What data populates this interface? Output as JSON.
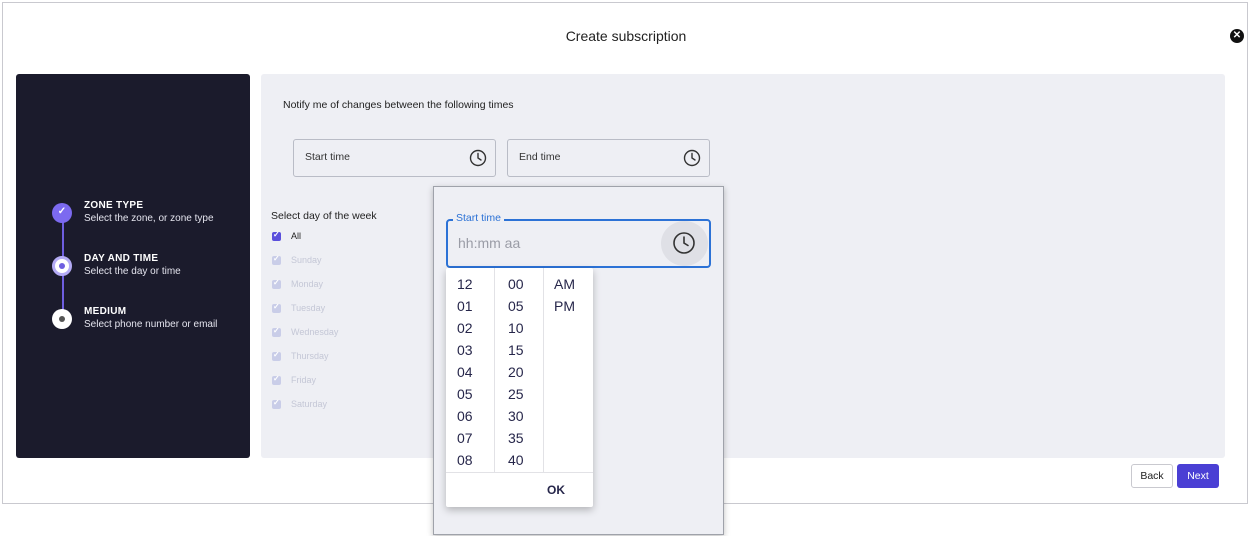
{
  "modal": {
    "title": "Create subscription"
  },
  "stepper": {
    "steps": [
      {
        "title": "ZONE TYPE",
        "subtitle": "Select the zone, or zone type",
        "state": "done"
      },
      {
        "title": "DAY AND TIME",
        "subtitle": "Select the day or time",
        "state": "active"
      },
      {
        "title": "MEDIUM",
        "subtitle": "Select phone number or email",
        "state": "idle"
      }
    ]
  },
  "form": {
    "notify_label": "Notify me of changes between the following times",
    "start_time_label": "Start time",
    "end_time_label": "End time",
    "days_label": "Select day of the week",
    "days": [
      {
        "label": "All",
        "checked": true,
        "enabled": true
      },
      {
        "label": "Sunday",
        "checked": true,
        "enabled": false
      },
      {
        "label": "Monday",
        "checked": true,
        "enabled": false
      },
      {
        "label": "Tuesday",
        "checked": true,
        "enabled": false
      },
      {
        "label": "Wednesday",
        "checked": true,
        "enabled": false
      },
      {
        "label": "Thursday",
        "checked": true,
        "enabled": false
      },
      {
        "label": "Friday",
        "checked": true,
        "enabled": false
      },
      {
        "label": "Saturday",
        "checked": true,
        "enabled": false
      }
    ]
  },
  "time_popup": {
    "field_label": "Start time",
    "placeholder": "hh:mm aa",
    "hours": [
      "12",
      "01",
      "02",
      "03",
      "04",
      "05",
      "06",
      "07",
      "08"
    ],
    "minutes": [
      "00",
      "05",
      "10",
      "15",
      "20",
      "25",
      "30",
      "35",
      "40"
    ],
    "periods": [
      "AM",
      "PM"
    ],
    "ok_label": "OK"
  },
  "footer": {
    "back_label": "Back",
    "next_label": "Next"
  },
  "colors": {
    "accent": "#4a3fd4",
    "stepper_bg": "#1b1b2c",
    "focus_blue": "#2c72d6"
  }
}
